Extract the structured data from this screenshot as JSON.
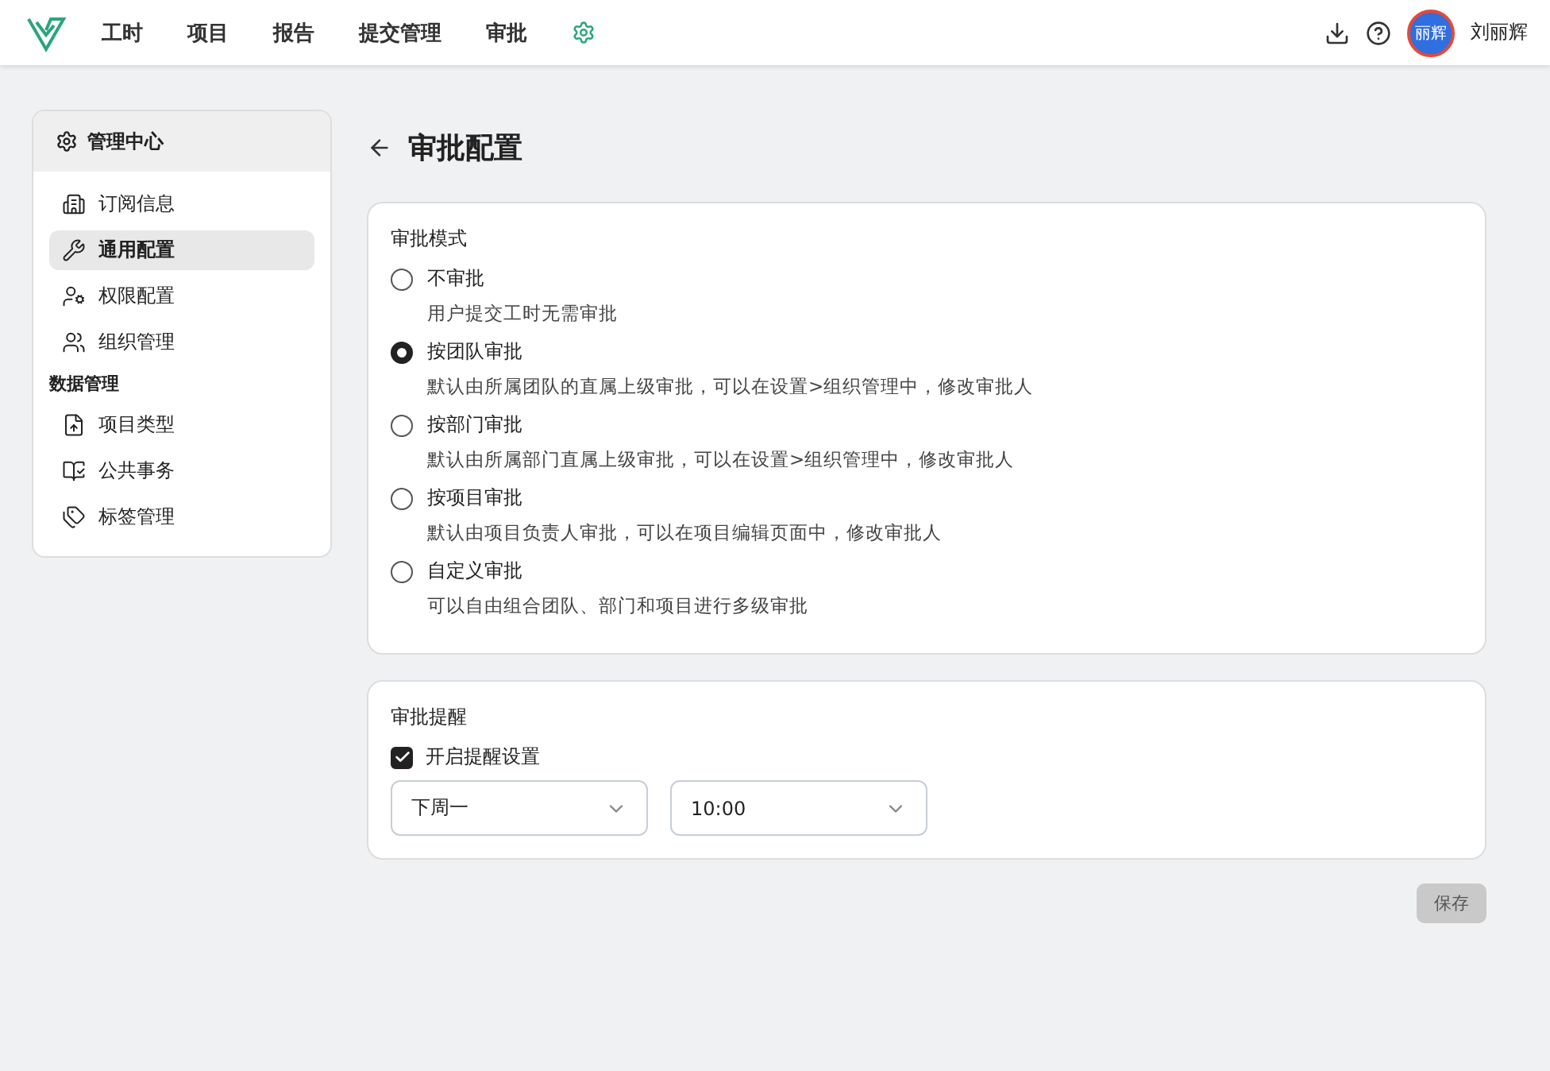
{
  "nav": {
    "items": [
      {
        "label": "工时",
        "selected": false
      },
      {
        "label": "项目",
        "selected": false
      },
      {
        "label": "报告",
        "selected": false
      },
      {
        "label": "提交管理",
        "selected": false
      },
      {
        "label": "审批",
        "selected": false
      }
    ],
    "user": {
      "avatar_text": "丽辉",
      "name": "刘丽辉"
    }
  },
  "sidebar": {
    "title": "管理中心",
    "items": [
      {
        "kind": "item",
        "label": "订阅信息",
        "selected": false
      },
      {
        "kind": "item",
        "label": "通用配置",
        "selected": true
      },
      {
        "kind": "item",
        "label": "权限配置",
        "selected": false
      },
      {
        "kind": "item",
        "label": "组织管理",
        "selected": false
      },
      {
        "kind": "section",
        "label": "数据管理"
      },
      {
        "kind": "item",
        "label": "项目类型",
        "selected": false
      },
      {
        "kind": "item",
        "label": "公共事务",
        "selected": false
      },
      {
        "kind": "item",
        "label": "标签管理",
        "selected": false
      }
    ]
  },
  "page": {
    "title": "审批配置"
  },
  "approval_mode": {
    "title": "审批模式",
    "options": [
      {
        "label": "不审批",
        "description": "用户提交工时无需审批",
        "selected": false
      },
      {
        "label": "按团队审批",
        "description": "默认由所属团队的直属上级审批，可以在设置>组织管理中，修改审批人",
        "selected": true
      },
      {
        "label": "按部门审批",
        "description": "默认由所属部门直属上级审批，可以在设置>组织管理中，修改审批人",
        "selected": false
      },
      {
        "label": "按项目审批",
        "description": "默认由项目负责人审批，可以在项目编辑页面中，修改审批人",
        "selected": false
      },
      {
        "label": "自定义审批",
        "description": "可以自由组合团队、部门和项目进行多级审批",
        "selected": false
      }
    ]
  },
  "reminder": {
    "title": "审批提醒",
    "checkbox": {
      "label": "开启提醒设置",
      "checked": true
    },
    "selects": [
      {
        "value": "下周一"
      },
      {
        "value": "10:00"
      }
    ]
  },
  "save_button": {
    "label": "保存",
    "disabled": true
  }
}
